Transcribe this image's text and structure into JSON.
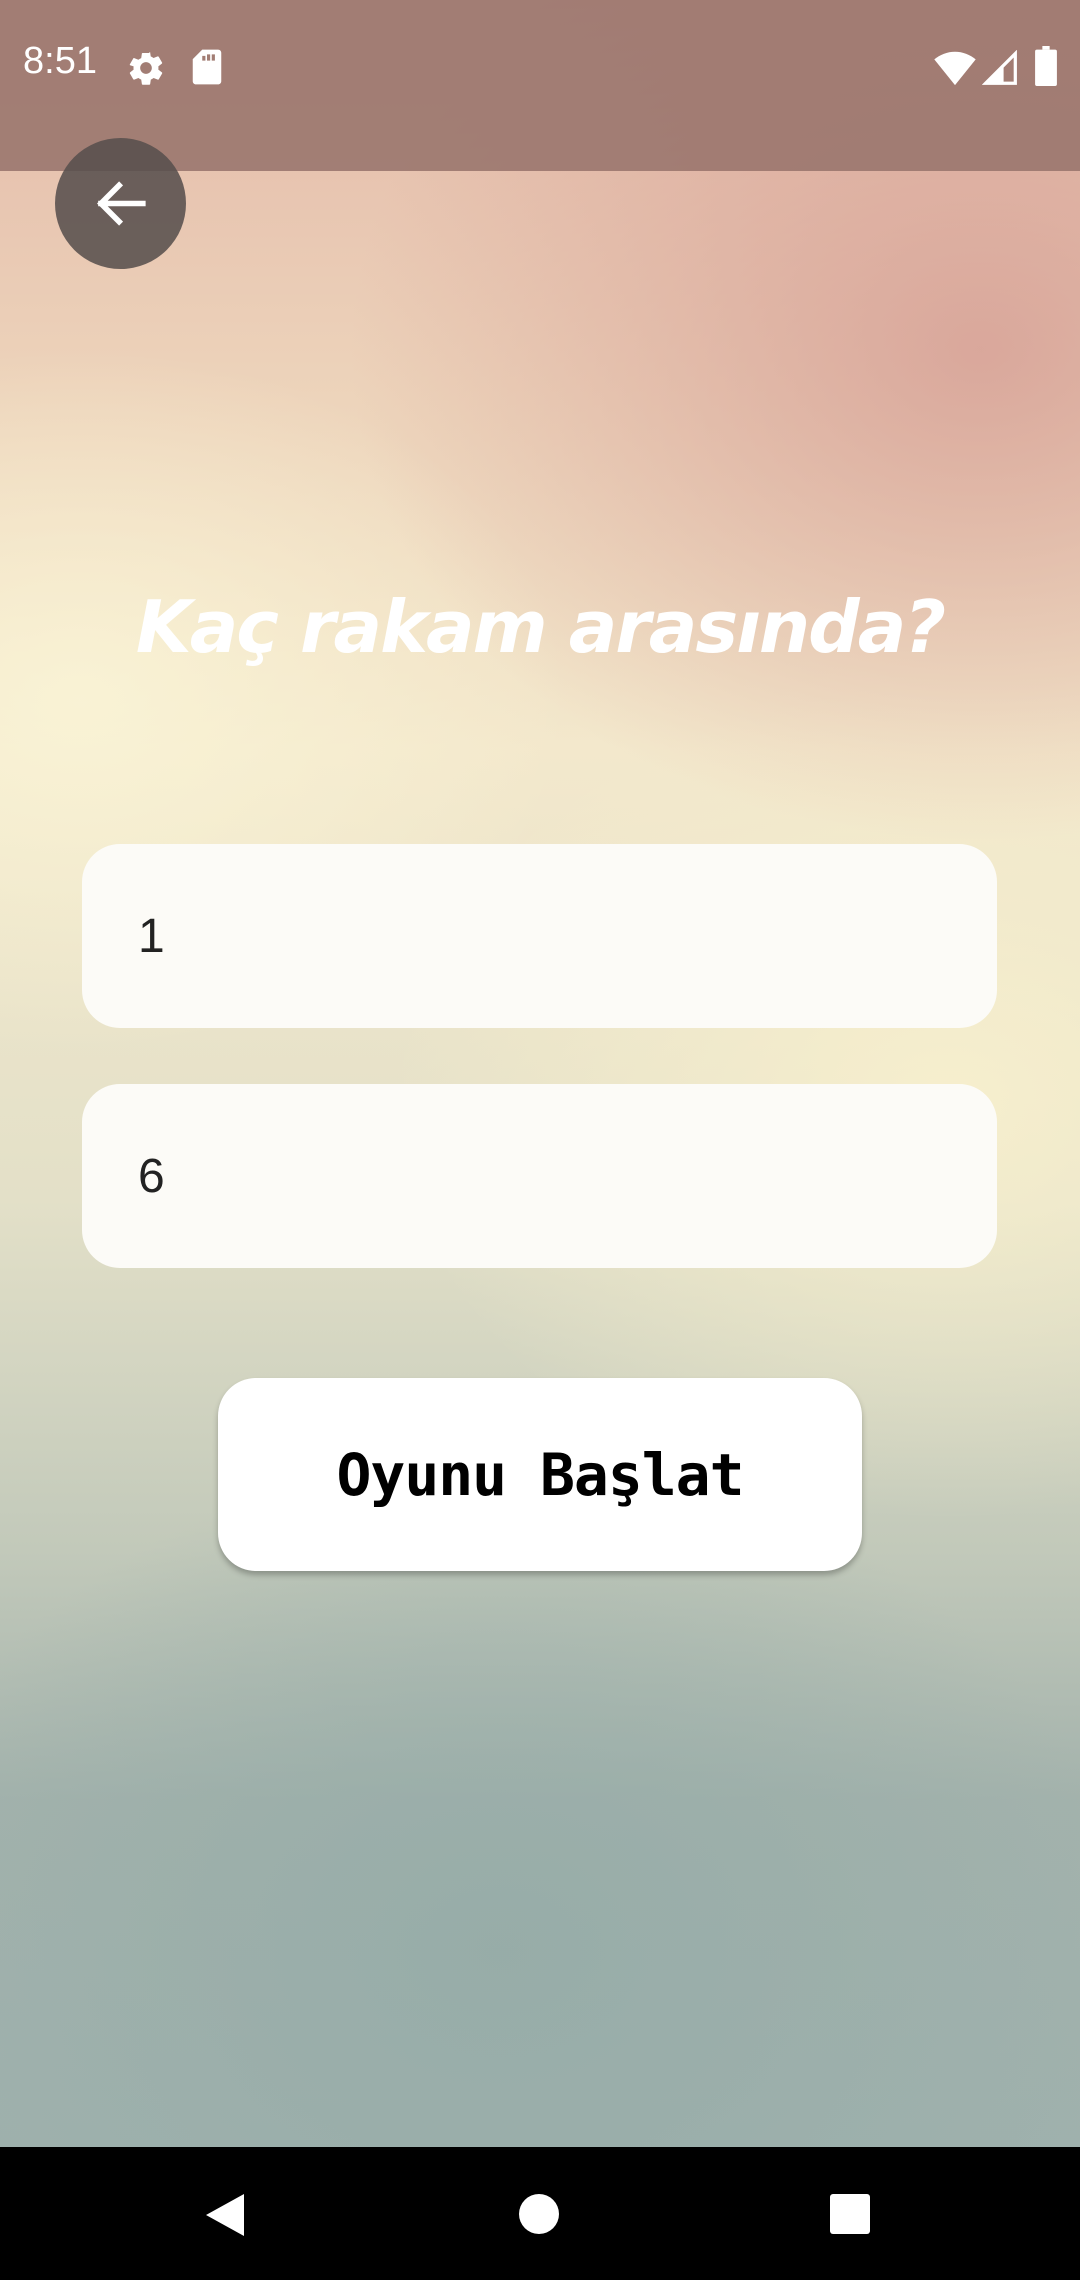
{
  "status_bar": {
    "time": "8:51",
    "left_icons": [
      "gear-icon",
      "sd-card-icon"
    ],
    "right_icons": [
      "wifi-icon",
      "signal-icon",
      "battery-icon"
    ]
  },
  "header": {
    "back_icon": "arrow-left-icon"
  },
  "main": {
    "title": "Kaç rakam arasında?",
    "min_value": "1",
    "max_value": "6",
    "start_button_label": "Oyunu Başlat"
  },
  "nav_bar": {
    "buttons": [
      "back-triangle-icon",
      "home-circle-icon",
      "recents-square-icon"
    ]
  },
  "colors": {
    "status_bar": "#98746c",
    "field_background": "#fcfbf7",
    "button_background": "#ffffff",
    "title_text": "#ffffff"
  }
}
